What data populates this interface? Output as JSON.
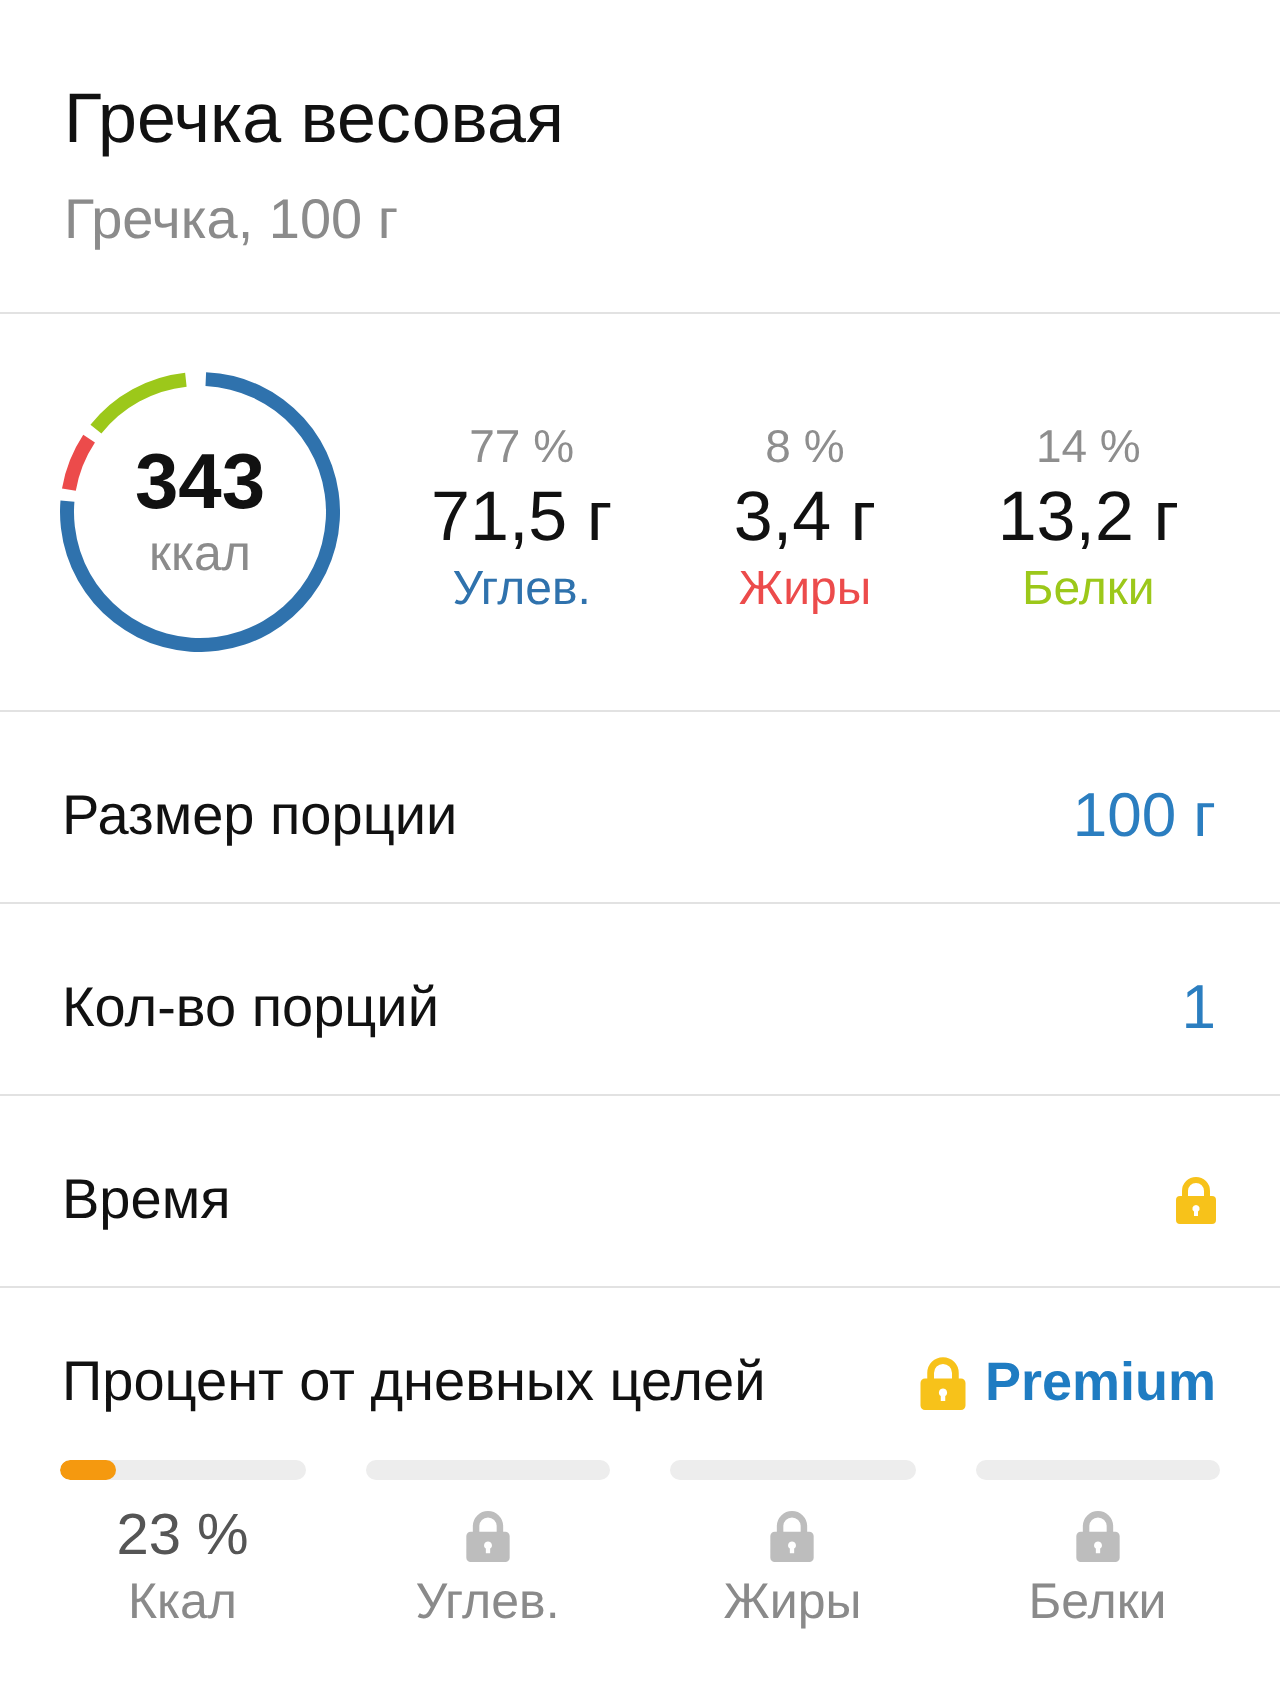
{
  "header": {
    "title": "Гречка весовая",
    "subtitle": "Гречка, 100 г"
  },
  "calories": {
    "value": "343",
    "unit": "ккал",
    "chart_data": {
      "type": "donut",
      "values": [
        77,
        8,
        14
      ]
    }
  },
  "macros": [
    {
      "percent": "77 %",
      "amount": "71,5 г",
      "name": "Углев.",
      "color": "#2f72ad"
    },
    {
      "percent": "8 %",
      "amount": "3,4 г",
      "name": "Жиры",
      "color": "#ec4b4b"
    },
    {
      "percent": "14 %",
      "amount": "13,2 г",
      "name": "Белки",
      "color": "#9cc81a"
    }
  ],
  "rows": [
    {
      "label": "Размер порции",
      "value": "100 г",
      "locked": false
    },
    {
      "label": "Кол-во порций",
      "value": "1",
      "locked": false
    },
    {
      "label": "Время",
      "locked": true
    }
  ],
  "goals_section": {
    "title": "Процент от дневных целей",
    "premium": {
      "label": "Premium",
      "locked": true
    },
    "goals": [
      {
        "label": "Ккал",
        "value": "23 %",
        "level": 0.23,
        "locked": false
      },
      {
        "label": "Углев.",
        "locked": true
      },
      {
        "label": "Жиры",
        "locked": true
      },
      {
        "label": "Белки",
        "locked": true
      }
    ]
  }
}
